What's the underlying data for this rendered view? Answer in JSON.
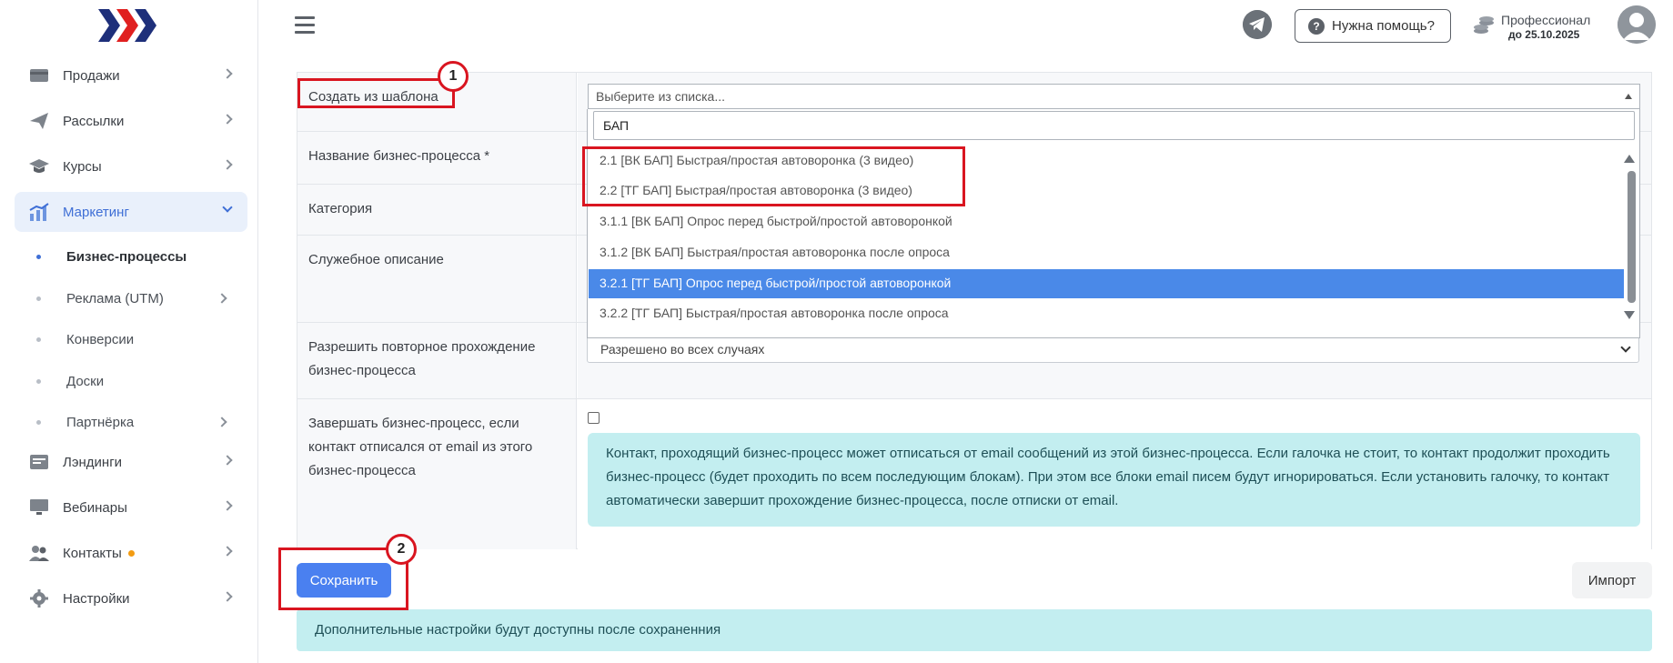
{
  "sidebar": {
    "items": [
      {
        "label": "Продажи",
        "icon": "wallet-icon"
      },
      {
        "label": "Рассылки",
        "icon": "paper-plane-icon"
      },
      {
        "label": "Курсы",
        "icon": "graduation-cap-icon"
      },
      {
        "label": "Маркетинг",
        "icon": "chart-icon"
      },
      {
        "label": "Лэндинги",
        "icon": "landing-icon"
      },
      {
        "label": "Вебинары",
        "icon": "monitor-icon"
      },
      {
        "label": "Контакты",
        "icon": "users-icon"
      },
      {
        "label": "Настройки",
        "icon": "gear-icon"
      }
    ],
    "sub_items": [
      {
        "label": "Бизнес-процессы"
      },
      {
        "label": "Реклама (UTM)"
      },
      {
        "label": "Конверсии"
      },
      {
        "label": "Доски"
      },
      {
        "label": "Партнёрка"
      }
    ]
  },
  "header": {
    "help_label": "Нужна помощь?",
    "plan_name": "Профессионал",
    "plan_until": "до 25.10.2025"
  },
  "form": {
    "template_label": "Создать из шаблона",
    "template_placeholder": "Выберите из списка...",
    "name_label": "Название бизнес-процесса *",
    "category_label": "Категория",
    "description_label": "Служебное описание",
    "repeat_label": "Разрешить повторное прохождение бизнес-процесса",
    "repeat_value": "Разрешено во всех случаях",
    "finish_label": "Завершать бизнес-процесс, если контакт отписался от email из этого бизнес-процесса",
    "finish_info": "Контакт, проходящий бизнес-процесс может отписаться от email сообщений из этой бизнес-процесса. Если галочка не стоит, то контакт продолжит проходить бизнес-процесс (будет проходить по всем последующим блокам). При этом все блоки email писем будут игнорироваться. Если установить галочку, то контакт автоматически завершит прохождение бизнес-процесса, после отписки от email."
  },
  "dropdown": {
    "search_value": "БАП",
    "options": [
      "2.1 [ВК БАП] Быстрая/простая автоворонка (3 видео)",
      "2.2 [ТГ БАП] Быстрая/простая автоворонка (3 видео)",
      "3.1.1 [ВК БАП] Опрос перед быстрой/простой автоворонкой",
      "3.1.2 [ВК БАП] Быстрая/простая автоворонка после опроса",
      "3.2.1 [ТГ БАП] Опрос перед быстрой/простой автоворонкой",
      "3.2.2 [ТГ БАП] Быстрая/простая автоворонка после опроса"
    ],
    "selected_index": 4
  },
  "actions": {
    "save_label": "Сохранить",
    "import_label": "Импорт",
    "note": "Дополнительные настройки будут доступны после сохраненния"
  },
  "annotations": {
    "badge1": "1",
    "badge2": "2"
  },
  "colors": {
    "accent": "#4a80f0",
    "annotation": "#d91520",
    "info_bg": "#c3eef0",
    "logo_red": "#e02020",
    "logo_blue": "#1e2f7a"
  }
}
